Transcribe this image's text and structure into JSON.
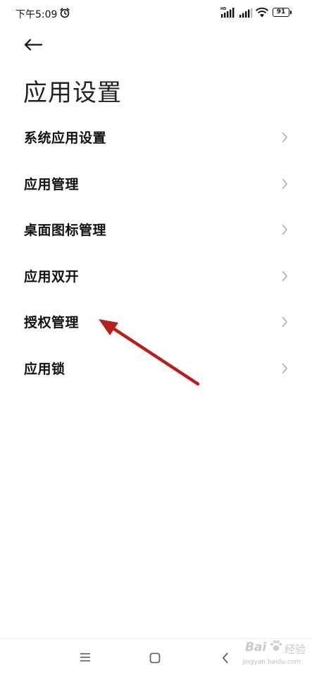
{
  "status_bar": {
    "time": "下午5:09",
    "battery": "91",
    "icons": [
      "alarm-icon",
      "signal-hd-icon",
      "signal-icon",
      "wifi-icon",
      "battery-icon"
    ]
  },
  "header": {
    "back_icon": "back-arrow-icon",
    "title": "应用设置"
  },
  "menu": {
    "items": [
      {
        "label": "系统应用设置"
      },
      {
        "label": "应用管理"
      },
      {
        "label": "桌面图标管理"
      },
      {
        "label": "应用双开"
      },
      {
        "label": "授权管理"
      },
      {
        "label": "应用锁"
      }
    ]
  },
  "annotation": {
    "arrow_color": "#b81f1a",
    "points_to": "授权管理"
  },
  "nav_bar": {
    "icons": [
      "menu-icon",
      "home-icon",
      "back-icon"
    ]
  },
  "watermark": {
    "brand": "Bai",
    "suffix": "经验",
    "url": "jingyan.baidu.com"
  }
}
